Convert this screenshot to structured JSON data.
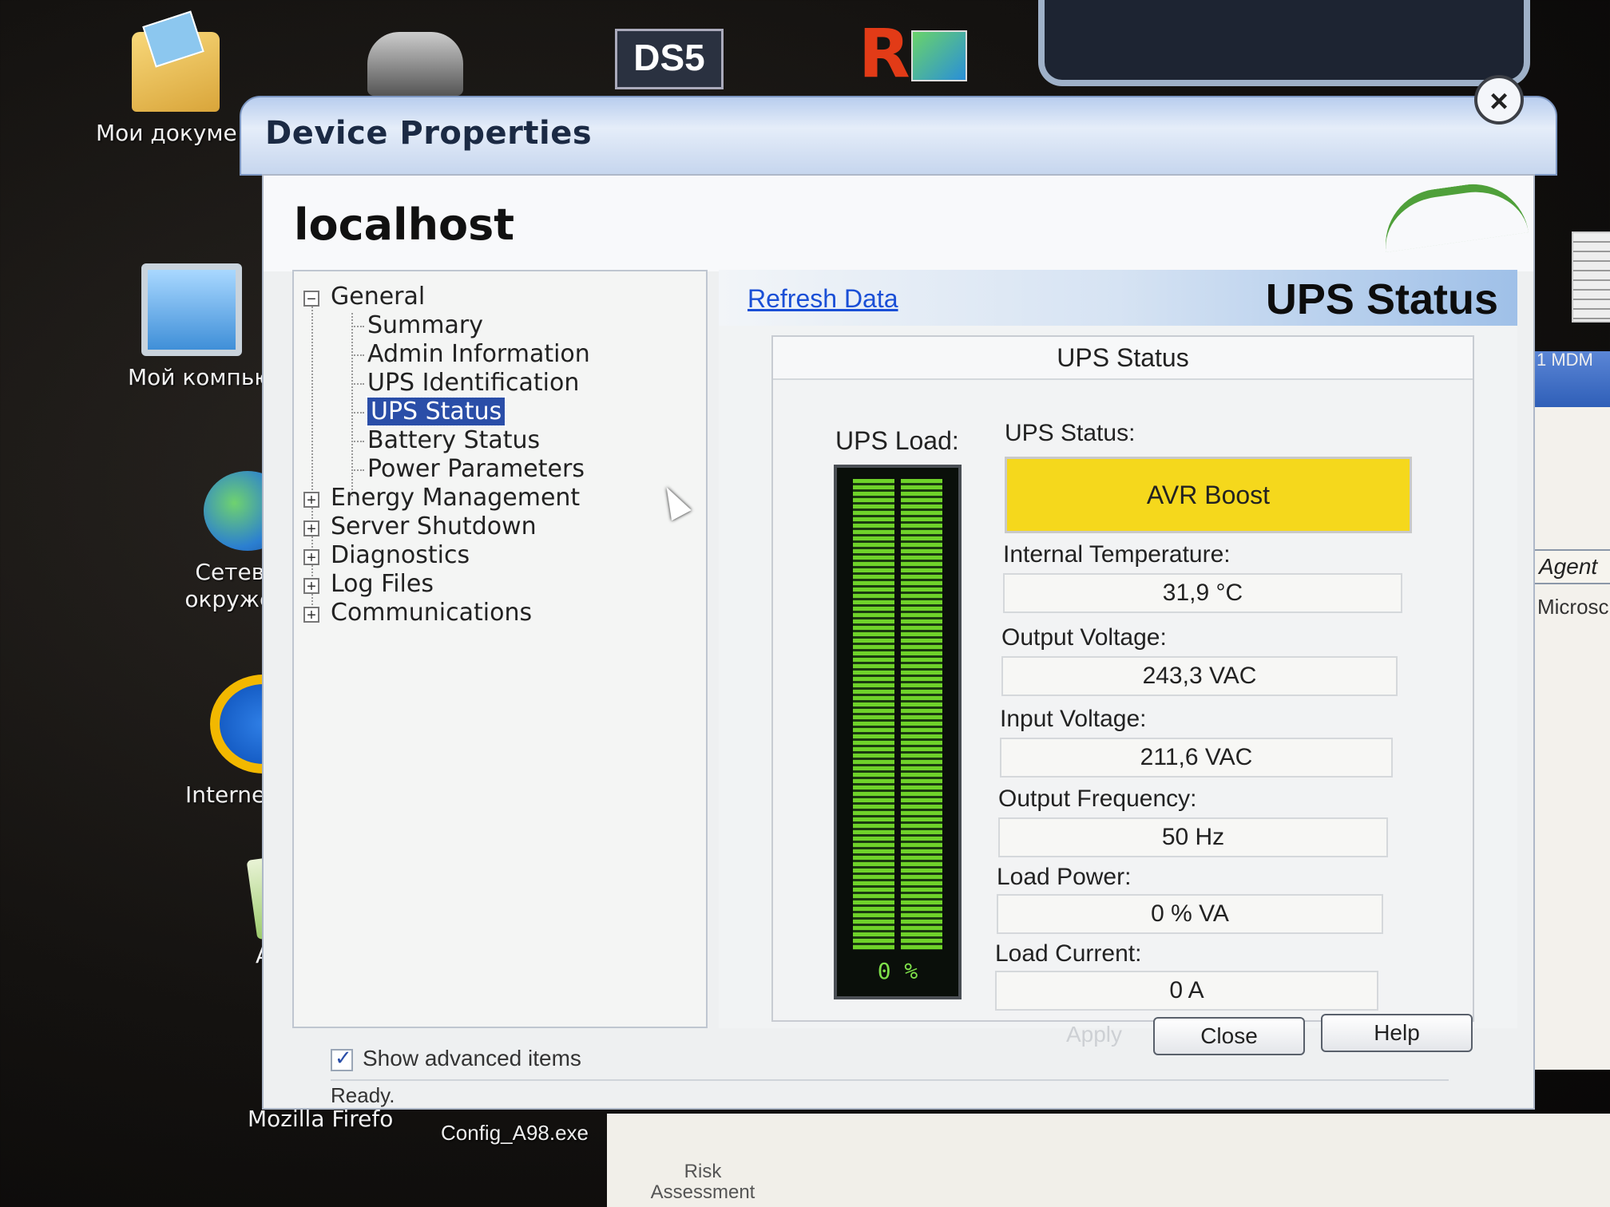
{
  "desktop": {
    "icons": [
      {
        "label": "Мои докуме",
        "icon": "my-documents-icon"
      },
      {
        "label": "Мой компью",
        "icon": "my-computer-icon"
      },
      {
        "label": "Сетевое окружени",
        "icon": "network-places-icon"
      },
      {
        "label": "Internet Expl",
        "icon": "internet-explorer-icon"
      },
      {
        "label": "AkelPad",
        "icon": "akelpad-icon"
      },
      {
        "label": "Mozilla Firefo",
        "icon": "firefox-icon"
      }
    ],
    "bottom_label": "Config_A98.exe",
    "top_icons": [
      "DS5",
      "R"
    ]
  },
  "background_window": {
    "tab_label": "Agent",
    "list_text": "Microsc",
    "header_text": "1 MDM",
    "bottom_text": "Risk Assessment"
  },
  "dialog": {
    "title": "Device Properties",
    "close_symbol": "×",
    "host": "localhost",
    "tree": {
      "root": {
        "label": "General",
        "expander": "−"
      },
      "children": [
        "Summary",
        "Admin Information",
        "UPS Identification",
        "UPS Status",
        "Battery Status",
        "Power Parameters"
      ],
      "selected": "UPS Status",
      "collapsed": [
        {
          "label": "Energy Management",
          "expander": "+"
        },
        {
          "label": "Server Shutdown",
          "expander": "+"
        },
        {
          "label": "Diagnostics",
          "expander": "+"
        },
        {
          "label": "Log Files",
          "expander": "+"
        },
        {
          "label": "Communications",
          "expander": "+"
        }
      ]
    },
    "panel": {
      "refresh_link": "Refresh Data",
      "title": "UPS Status",
      "group_title": "UPS Status",
      "load": {
        "label": "UPS Load:",
        "value_text": "0 %",
        "percent": 0
      },
      "fields": [
        {
          "label": "UPS Status:",
          "value": "AVR Boost",
          "highlight": "#f5d81c"
        },
        {
          "label": "Internal Temperature:",
          "value": "31,9 °C"
        },
        {
          "label": "Output Voltage:",
          "value": "243,3 VAC"
        },
        {
          "label": "Input Voltage:",
          "value": "211,6 VAC"
        },
        {
          "label": "Output Frequency:",
          "value": "50 Hz"
        },
        {
          "label": "Load Power:",
          "value": "0 % VA"
        },
        {
          "label": "Load Current:",
          "value": "0 A"
        }
      ]
    },
    "show_advanced": {
      "label": "Show advanced items",
      "checked": true
    },
    "buttons": {
      "apply": "Apply",
      "close": "Close",
      "help": "Help"
    },
    "status": "Ready."
  }
}
